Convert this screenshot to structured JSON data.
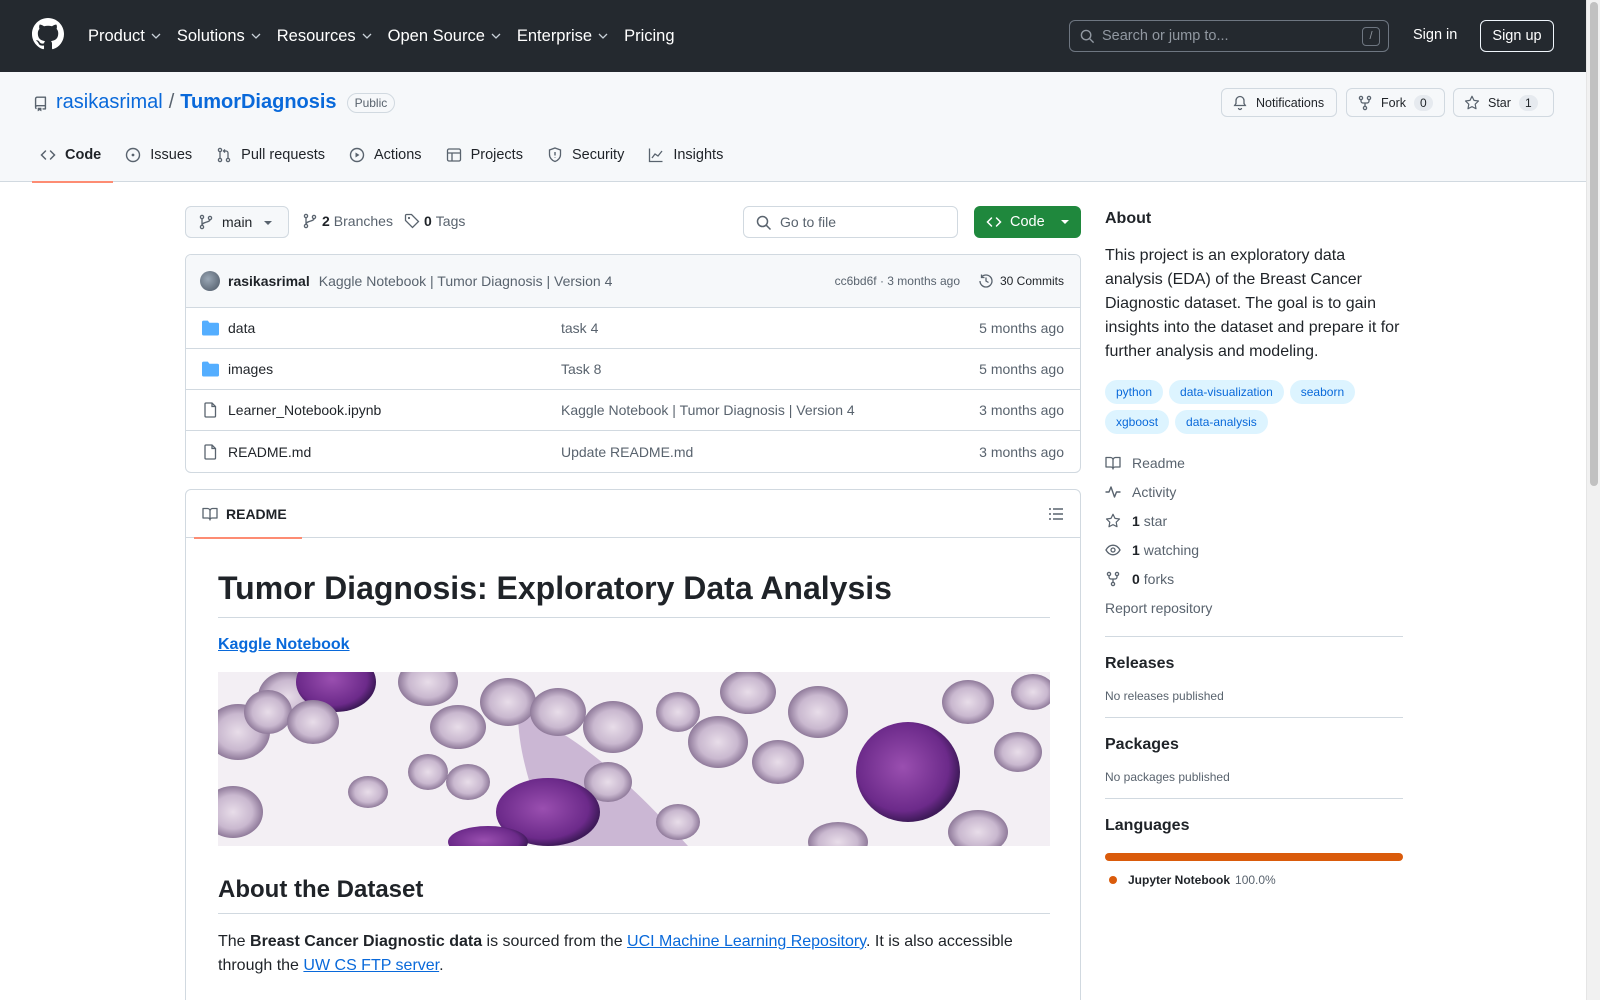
{
  "topnav": {
    "items": [
      {
        "label": "Product",
        "has_menu": true
      },
      {
        "label": "Solutions",
        "has_menu": true
      },
      {
        "label": "Resources",
        "has_menu": true
      },
      {
        "label": "Open Source",
        "has_menu": true
      },
      {
        "label": "Enterprise",
        "has_menu": true
      },
      {
        "label": "Pricing",
        "has_menu": false
      }
    ],
    "search_placeholder": "Search or jump to...",
    "search_shortcut": "/",
    "signin": "Sign in",
    "signup": "Sign up"
  },
  "repo": {
    "owner": "rasikasrimal",
    "separator": "/",
    "name": "TumorDiagnosis",
    "visibility": "Public",
    "notifications_label": "Notifications",
    "fork_label": "Fork",
    "fork_count": "0",
    "star_label": "Star",
    "star_count": "1"
  },
  "tabs": [
    {
      "label": "Code",
      "icon": "code-icon",
      "active": true
    },
    {
      "label": "Issues",
      "icon": "issue-icon",
      "active": false
    },
    {
      "label": "Pull requests",
      "icon": "pull-request-icon",
      "active": false
    },
    {
      "label": "Actions",
      "icon": "play-icon",
      "active": false
    },
    {
      "label": "Projects",
      "icon": "table-icon",
      "active": false
    },
    {
      "label": "Security",
      "icon": "shield-icon",
      "active": false
    },
    {
      "label": "Insights",
      "icon": "graph-icon",
      "active": false
    }
  ],
  "toolbar": {
    "branch": "main",
    "branches_count": "2",
    "branches_label": "Branches",
    "tags_count": "0",
    "tags_label": "Tags",
    "goto_placeholder": "Go to file",
    "code_label": "Code"
  },
  "commit": {
    "author": "rasikasrimal",
    "message": "Kaggle Notebook | Tumor Diagnosis | Version 4",
    "hash": "cc6bd6f",
    "dot": "·",
    "age": "3 months ago",
    "commits_label": "30 Commits"
  },
  "files": [
    {
      "name": "data",
      "type": "folder",
      "message": "task 4",
      "age": "5 months ago"
    },
    {
      "name": "images",
      "type": "folder",
      "message": "Task 8",
      "age": "5 months ago"
    },
    {
      "name": "Learner_Notebook.ipynb",
      "type": "file",
      "message": "Kaggle Notebook | Tumor Diagnosis | Version 4",
      "age": "3 months ago"
    },
    {
      "name": "README.md",
      "type": "file",
      "message": "Update README.md",
      "age": "3 months ago"
    }
  ],
  "readme": {
    "tab_label": "README",
    "title": "Tumor Diagnosis: Exploratory Data Analysis",
    "kaggle_link": "Kaggle Notebook",
    "section_title": "About the Dataset",
    "p1_a": "The ",
    "p1_bold": "Breast Cancer Diagnostic data",
    "p1_b": " is sourced from the ",
    "p1_link1": "UCI Machine Learning Repository",
    "p1_c": ". It is also accessible through the ",
    "p1_link2": "UW CS FTP server",
    "p1_d": "."
  },
  "sidebar": {
    "about_title": "About",
    "about_text": "This project is an exploratory data analysis (EDA) of the Breast Cancer Diagnostic dataset. The goal is to gain insights into the dataset and prepare it for further analysis and modeling.",
    "topics": [
      "python",
      "data-visualization",
      "seaborn",
      "xgboost",
      "data-analysis"
    ],
    "readme_label": "Readme",
    "activity_label": "Activity",
    "stars_count": "1",
    "stars_label": "star",
    "watching_count": "1",
    "watching_label": "watching",
    "forks_count": "0",
    "forks_label": "forks",
    "report_label": "Report repository",
    "releases_title": "Releases",
    "releases_sub": "No releases published",
    "packages_title": "Packages",
    "packages_sub": "No packages published",
    "languages_title": "Languages",
    "language_name": "Jupyter Notebook",
    "language_pct": "100.0%",
    "language_color": "#da5b0b"
  },
  "colors": {
    "header_bg": "#24292f",
    "link": "#0969da",
    "primary_button": "#1f883d",
    "tab_underline": "#fd8c73",
    "topic_bg": "#ddf4ff"
  }
}
